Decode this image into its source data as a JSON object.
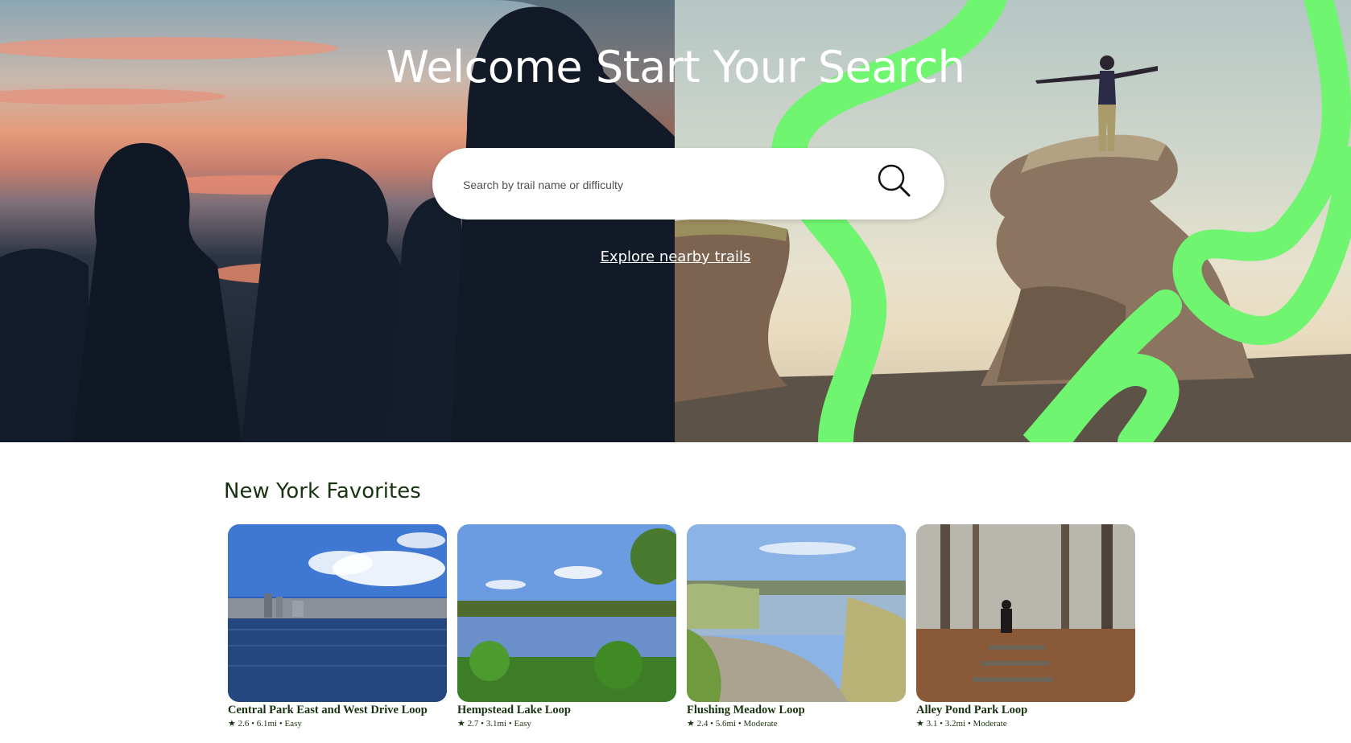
{
  "hero": {
    "title": "Welcome Start Your Search",
    "explore_link": "Explore nearby trails"
  },
  "search": {
    "placeholder": "Search by trail name or difficulty",
    "icon": "search-icon"
  },
  "favorites": {
    "heading": "New York Favorites",
    "trails": [
      {
        "name": "Central Park East and West Drive Loop",
        "rating": "2.6",
        "distance": "6.1mi",
        "difficulty": "Easy"
      },
      {
        "name": "Hempstead Lake Loop",
        "rating": "2.7",
        "distance": "3.1mi",
        "difficulty": "Easy"
      },
      {
        "name": "Flushing Meadow Loop",
        "rating": "2.4",
        "distance": "5.6mi",
        "difficulty": "Moderate"
      },
      {
        "name": "Alley Pond Park Loop",
        "rating": "3.1",
        "distance": "3.2mi",
        "difficulty": "Moderate"
      }
    ],
    "star_glyph": "★",
    "separator": "•"
  },
  "colors": {
    "accent_green": "#6ff56f",
    "heading_green": "#17330f"
  }
}
